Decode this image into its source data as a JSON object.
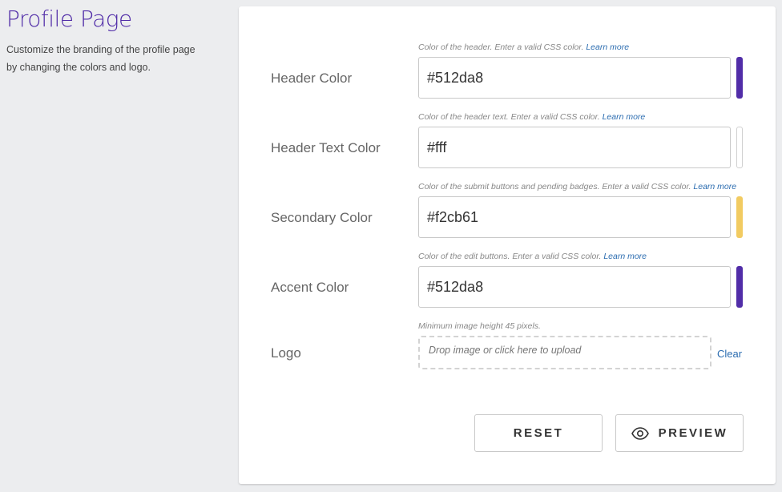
{
  "page": {
    "title": "Profile Page",
    "description": "Customize the branding of the profile page by changing the colors and logo."
  },
  "fields": [
    {
      "label": "Header Color",
      "hint": "Color of the header. Enter a valid CSS color.",
      "learn_more": "Learn more",
      "value": "#512da8",
      "swatch_color": "#512da8"
    },
    {
      "label": "Header Text Color",
      "hint": "Color of the header text. Enter a valid CSS color.",
      "learn_more": "Learn more",
      "value": "#fff",
      "swatch_color": "#ffffff"
    },
    {
      "label": "Secondary Color",
      "hint": "Color of the submit buttons and pending badges. Enter a valid CSS color.",
      "learn_more": "Learn more",
      "value": "#f2cb61",
      "swatch_color": "#f2cb61"
    },
    {
      "label": "Accent Color",
      "hint": "Color of the edit buttons. Enter a valid CSS color.",
      "learn_more": "Learn more",
      "value": "#512da8",
      "swatch_color": "#512da8"
    }
  ],
  "logo": {
    "label": "Logo",
    "hint": "Minimum image height 45 pixels.",
    "dropzone_text": "Drop image or click here to upload",
    "clear_label": "Clear"
  },
  "actions": {
    "reset_label": "RESET",
    "preview_label": "PREVIEW",
    "preview_icon": "eye-icon"
  },
  "colors": {
    "title": "#512da8",
    "link": "#2b6cb0",
    "background": "#ecedef"
  }
}
